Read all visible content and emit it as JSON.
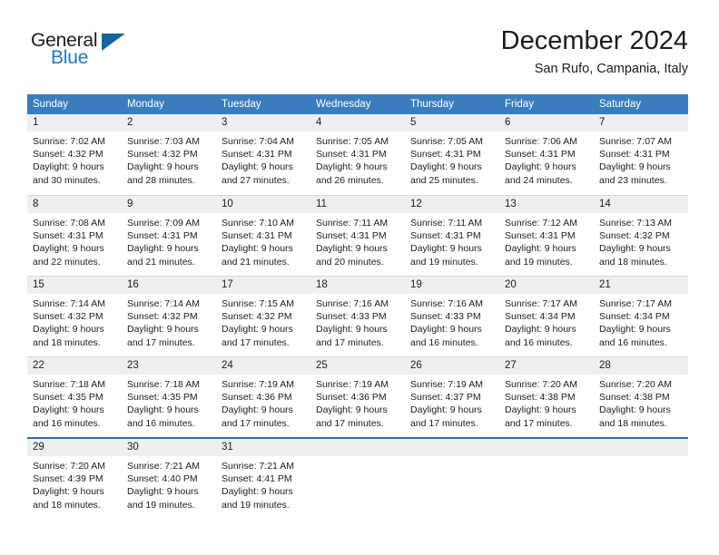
{
  "brand": {
    "name_part1": "General",
    "name_part2": "Blue",
    "flag_icon": "blue-flag-triangle-icon"
  },
  "header": {
    "month_title": "December 2024",
    "location": "San Rufo, Campania, Italy"
  },
  "colors": {
    "header_blue": "#3a7dbf",
    "brand_blue": "#2277c8",
    "flag_blue": "#15659e",
    "day_number_bg": "#efefef",
    "row_divider": "#d8d8d8",
    "last_row_border": "#2f6ea8"
  },
  "weekdays": [
    "Sunday",
    "Monday",
    "Tuesday",
    "Wednesday",
    "Thursday",
    "Friday",
    "Saturday"
  ],
  "weeks": [
    [
      {
        "day": "1",
        "sunrise": "Sunrise: 7:02 AM",
        "sunset": "Sunset: 4:32 PM",
        "daylight1": "Daylight: 9 hours",
        "daylight2": "and 30 minutes."
      },
      {
        "day": "2",
        "sunrise": "Sunrise: 7:03 AM",
        "sunset": "Sunset: 4:32 PM",
        "daylight1": "Daylight: 9 hours",
        "daylight2": "and 28 minutes."
      },
      {
        "day": "3",
        "sunrise": "Sunrise: 7:04 AM",
        "sunset": "Sunset: 4:31 PM",
        "daylight1": "Daylight: 9 hours",
        "daylight2": "and 27 minutes."
      },
      {
        "day": "4",
        "sunrise": "Sunrise: 7:05 AM",
        "sunset": "Sunset: 4:31 PM",
        "daylight1": "Daylight: 9 hours",
        "daylight2": "and 26 minutes."
      },
      {
        "day": "5",
        "sunrise": "Sunrise: 7:05 AM",
        "sunset": "Sunset: 4:31 PM",
        "daylight1": "Daylight: 9 hours",
        "daylight2": "and 25 minutes."
      },
      {
        "day": "6",
        "sunrise": "Sunrise: 7:06 AM",
        "sunset": "Sunset: 4:31 PM",
        "daylight1": "Daylight: 9 hours",
        "daylight2": "and 24 minutes."
      },
      {
        "day": "7",
        "sunrise": "Sunrise: 7:07 AM",
        "sunset": "Sunset: 4:31 PM",
        "daylight1": "Daylight: 9 hours",
        "daylight2": "and 23 minutes."
      }
    ],
    [
      {
        "day": "8",
        "sunrise": "Sunrise: 7:08 AM",
        "sunset": "Sunset: 4:31 PM",
        "daylight1": "Daylight: 9 hours",
        "daylight2": "and 22 minutes."
      },
      {
        "day": "9",
        "sunrise": "Sunrise: 7:09 AM",
        "sunset": "Sunset: 4:31 PM",
        "daylight1": "Daylight: 9 hours",
        "daylight2": "and 21 minutes."
      },
      {
        "day": "10",
        "sunrise": "Sunrise: 7:10 AM",
        "sunset": "Sunset: 4:31 PM",
        "daylight1": "Daylight: 9 hours",
        "daylight2": "and 21 minutes."
      },
      {
        "day": "11",
        "sunrise": "Sunrise: 7:11 AM",
        "sunset": "Sunset: 4:31 PM",
        "daylight1": "Daylight: 9 hours",
        "daylight2": "and 20 minutes."
      },
      {
        "day": "12",
        "sunrise": "Sunrise: 7:11 AM",
        "sunset": "Sunset: 4:31 PM",
        "daylight1": "Daylight: 9 hours",
        "daylight2": "and 19 minutes."
      },
      {
        "day": "13",
        "sunrise": "Sunrise: 7:12 AM",
        "sunset": "Sunset: 4:31 PM",
        "daylight1": "Daylight: 9 hours",
        "daylight2": "and 19 minutes."
      },
      {
        "day": "14",
        "sunrise": "Sunrise: 7:13 AM",
        "sunset": "Sunset: 4:32 PM",
        "daylight1": "Daylight: 9 hours",
        "daylight2": "and 18 minutes."
      }
    ],
    [
      {
        "day": "15",
        "sunrise": "Sunrise: 7:14 AM",
        "sunset": "Sunset: 4:32 PM",
        "daylight1": "Daylight: 9 hours",
        "daylight2": "and 18 minutes."
      },
      {
        "day": "16",
        "sunrise": "Sunrise: 7:14 AM",
        "sunset": "Sunset: 4:32 PM",
        "daylight1": "Daylight: 9 hours",
        "daylight2": "and 17 minutes."
      },
      {
        "day": "17",
        "sunrise": "Sunrise: 7:15 AM",
        "sunset": "Sunset: 4:32 PM",
        "daylight1": "Daylight: 9 hours",
        "daylight2": "and 17 minutes."
      },
      {
        "day": "18",
        "sunrise": "Sunrise: 7:16 AM",
        "sunset": "Sunset: 4:33 PM",
        "daylight1": "Daylight: 9 hours",
        "daylight2": "and 17 minutes."
      },
      {
        "day": "19",
        "sunrise": "Sunrise: 7:16 AM",
        "sunset": "Sunset: 4:33 PM",
        "daylight1": "Daylight: 9 hours",
        "daylight2": "and 16 minutes."
      },
      {
        "day": "20",
        "sunrise": "Sunrise: 7:17 AM",
        "sunset": "Sunset: 4:34 PM",
        "daylight1": "Daylight: 9 hours",
        "daylight2": "and 16 minutes."
      },
      {
        "day": "21",
        "sunrise": "Sunrise: 7:17 AM",
        "sunset": "Sunset: 4:34 PM",
        "daylight1": "Daylight: 9 hours",
        "daylight2": "and 16 minutes."
      }
    ],
    [
      {
        "day": "22",
        "sunrise": "Sunrise: 7:18 AM",
        "sunset": "Sunset: 4:35 PM",
        "daylight1": "Daylight: 9 hours",
        "daylight2": "and 16 minutes."
      },
      {
        "day": "23",
        "sunrise": "Sunrise: 7:18 AM",
        "sunset": "Sunset: 4:35 PM",
        "daylight1": "Daylight: 9 hours",
        "daylight2": "and 16 minutes."
      },
      {
        "day": "24",
        "sunrise": "Sunrise: 7:19 AM",
        "sunset": "Sunset: 4:36 PM",
        "daylight1": "Daylight: 9 hours",
        "daylight2": "and 17 minutes."
      },
      {
        "day": "25",
        "sunrise": "Sunrise: 7:19 AM",
        "sunset": "Sunset: 4:36 PM",
        "daylight1": "Daylight: 9 hours",
        "daylight2": "and 17 minutes."
      },
      {
        "day": "26",
        "sunrise": "Sunrise: 7:19 AM",
        "sunset": "Sunset: 4:37 PM",
        "daylight1": "Daylight: 9 hours",
        "daylight2": "and 17 minutes."
      },
      {
        "day": "27",
        "sunrise": "Sunrise: 7:20 AM",
        "sunset": "Sunset: 4:38 PM",
        "daylight1": "Daylight: 9 hours",
        "daylight2": "and 17 minutes."
      },
      {
        "day": "28",
        "sunrise": "Sunrise: 7:20 AM",
        "sunset": "Sunset: 4:38 PM",
        "daylight1": "Daylight: 9 hours",
        "daylight2": "and 18 minutes."
      }
    ],
    [
      {
        "day": "29",
        "sunrise": "Sunrise: 7:20 AM",
        "sunset": "Sunset: 4:39 PM",
        "daylight1": "Daylight: 9 hours",
        "daylight2": "and 18 minutes."
      },
      {
        "day": "30",
        "sunrise": "Sunrise: 7:21 AM",
        "sunset": "Sunset: 4:40 PM",
        "daylight1": "Daylight: 9 hours",
        "daylight2": "and 19 minutes."
      },
      {
        "day": "31",
        "sunrise": "Sunrise: 7:21 AM",
        "sunset": "Sunset: 4:41 PM",
        "daylight1": "Daylight: 9 hours",
        "daylight2": "and 19 minutes."
      },
      {
        "day": "",
        "sunrise": "",
        "sunset": "",
        "daylight1": "",
        "daylight2": ""
      },
      {
        "day": "",
        "sunrise": "",
        "sunset": "",
        "daylight1": "",
        "daylight2": ""
      },
      {
        "day": "",
        "sunrise": "",
        "sunset": "",
        "daylight1": "",
        "daylight2": ""
      },
      {
        "day": "",
        "sunrise": "",
        "sunset": "",
        "daylight1": "",
        "daylight2": ""
      }
    ]
  ]
}
